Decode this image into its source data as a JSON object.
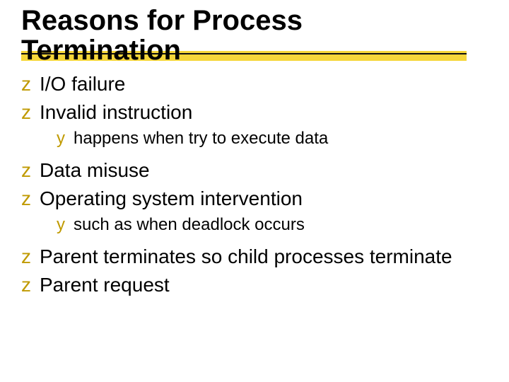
{
  "slide": {
    "title": "Reasons for Process Termination",
    "bullets": {
      "z": "z",
      "y": "y"
    },
    "items": [
      {
        "level": 1,
        "text": "I/O failure"
      },
      {
        "level": 1,
        "text": "Invalid instruction"
      },
      {
        "level": 2,
        "text": "happens when try to execute data"
      },
      {
        "level": 1,
        "text": "Data misuse"
      },
      {
        "level": 1,
        "text": "Operating system intervention"
      },
      {
        "level": 2,
        "text": "such as when deadlock occurs"
      },
      {
        "level": 1,
        "text": "Parent terminates so child processes terminate"
      },
      {
        "level": 1,
        "text": "Parent request"
      }
    ]
  }
}
